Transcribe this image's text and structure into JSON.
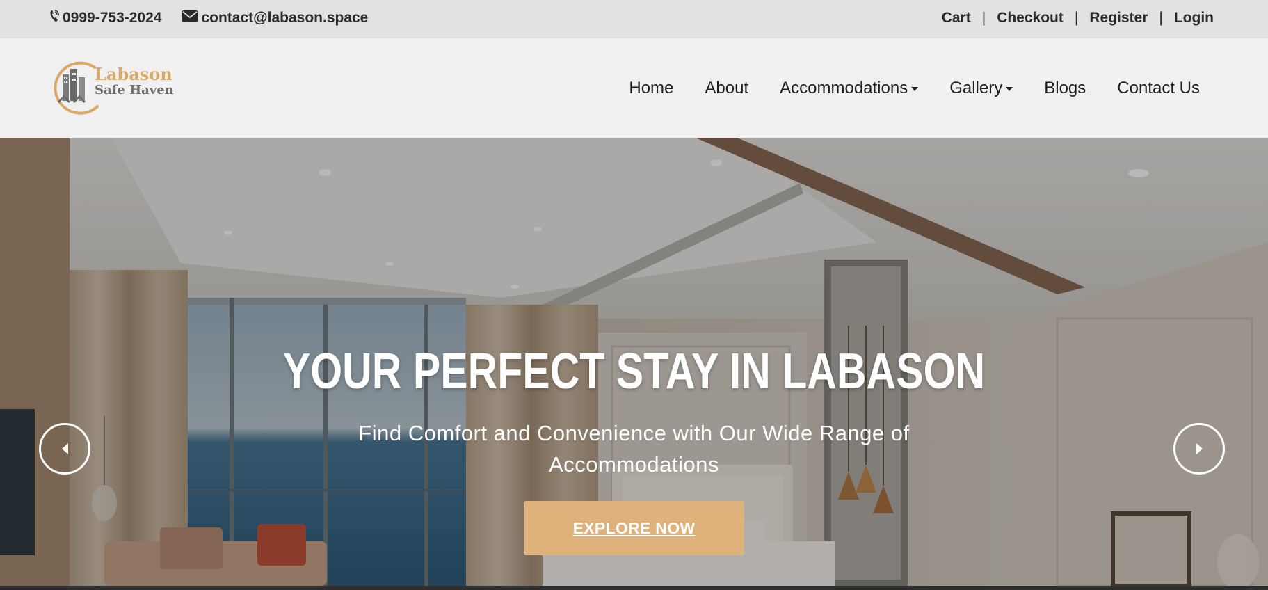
{
  "topbar": {
    "phone": "0999-753-2024",
    "email": "contact@labason.space",
    "links": [
      "Cart",
      "Checkout",
      "Register",
      "Login"
    ],
    "separator": "|"
  },
  "logo": {
    "line1": "Labason",
    "line2": "Safe Haven"
  },
  "nav": {
    "items": [
      {
        "label": "Home"
      },
      {
        "label": "About"
      },
      {
        "label": "Accommodations"
      },
      {
        "label": "Gallery"
      },
      {
        "label": "Blogs"
      },
      {
        "label": "Contact Us"
      }
    ]
  },
  "hero": {
    "title": "YOUR PERFECT STAY IN LABASON",
    "subtitle": "Find Comfort and Convenience with Our Wide Range of Accommodations",
    "cta_label": "EXPLORE NOW"
  },
  "colors": {
    "accent": "#e0b27b",
    "logo_gold": "#d9a867",
    "topbar_bg": "#e2e2e2",
    "nav_bg": "#f0f0f0"
  },
  "icons": {
    "phone": "phone-icon",
    "email": "envelope-icon",
    "prev": "chevron-left-icon",
    "next": "chevron-right-icon",
    "dropdown": "caret-down-icon"
  }
}
